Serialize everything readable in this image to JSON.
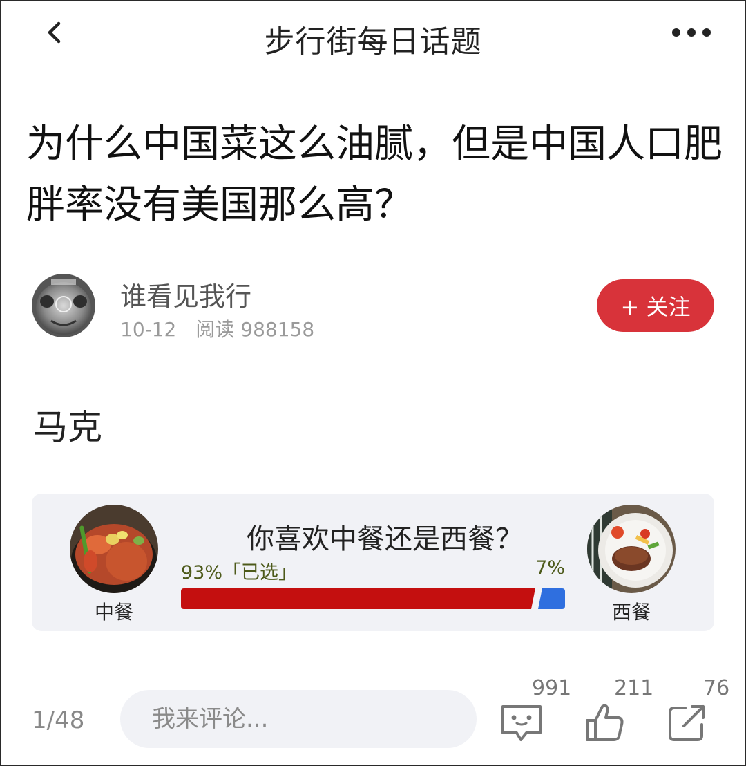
{
  "header": {
    "title": "步行街每日话题",
    "back_icon": "chevron-left-icon",
    "more_icon": "more-dots-icon"
  },
  "post": {
    "title": "为什么中国菜这么油腻，但是中国人口肥胖率没有美国那么高？",
    "body": "马克"
  },
  "author": {
    "name": "谁看见我行",
    "date": "10-12",
    "reads": "阅读 988158",
    "follow_label": "+ 关注"
  },
  "poll": {
    "question": "你喜欢中餐还是西餐？",
    "left": {
      "caption": "中餐",
      "percent_label": "93%「已选」",
      "value": 93
    },
    "right": {
      "caption": "西餐",
      "percent_label": "7%",
      "value": 7
    },
    "colors": {
      "left": "#c40f0f",
      "right": "#2f6fdf"
    }
  },
  "bottom": {
    "page": "1/48",
    "comment_placeholder": "我来评论...",
    "comments": "991",
    "likes": "211",
    "shares": "76"
  },
  "colors": {
    "accent": "#d8333a"
  }
}
